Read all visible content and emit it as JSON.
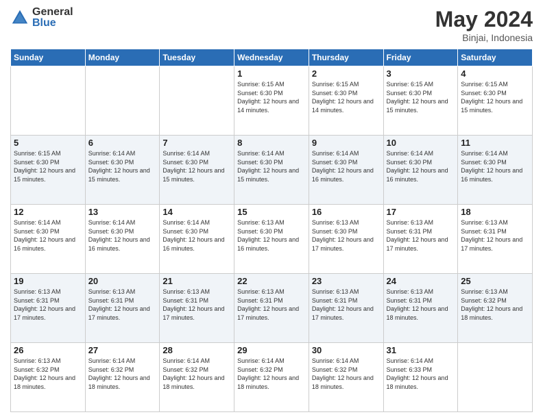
{
  "logo": {
    "general": "General",
    "blue": "Blue"
  },
  "title": "May 2024",
  "location": "Binjai, Indonesia",
  "headers": [
    "Sunday",
    "Monday",
    "Tuesday",
    "Wednesday",
    "Thursday",
    "Friday",
    "Saturday"
  ],
  "weeks": [
    [
      {
        "day": "",
        "info": ""
      },
      {
        "day": "",
        "info": ""
      },
      {
        "day": "",
        "info": ""
      },
      {
        "day": "1",
        "info": "Sunrise: 6:15 AM\nSunset: 6:30 PM\nDaylight: 12 hours and 14 minutes."
      },
      {
        "day": "2",
        "info": "Sunrise: 6:15 AM\nSunset: 6:30 PM\nDaylight: 12 hours and 14 minutes."
      },
      {
        "day": "3",
        "info": "Sunrise: 6:15 AM\nSunset: 6:30 PM\nDaylight: 12 hours and 15 minutes."
      },
      {
        "day": "4",
        "info": "Sunrise: 6:15 AM\nSunset: 6:30 PM\nDaylight: 12 hours and 15 minutes."
      }
    ],
    [
      {
        "day": "5",
        "info": "Sunrise: 6:15 AM\nSunset: 6:30 PM\nDaylight: 12 hours and 15 minutes."
      },
      {
        "day": "6",
        "info": "Sunrise: 6:14 AM\nSunset: 6:30 PM\nDaylight: 12 hours and 15 minutes."
      },
      {
        "day": "7",
        "info": "Sunrise: 6:14 AM\nSunset: 6:30 PM\nDaylight: 12 hours and 15 minutes."
      },
      {
        "day": "8",
        "info": "Sunrise: 6:14 AM\nSunset: 6:30 PM\nDaylight: 12 hours and 15 minutes."
      },
      {
        "day": "9",
        "info": "Sunrise: 6:14 AM\nSunset: 6:30 PM\nDaylight: 12 hours and 16 minutes."
      },
      {
        "day": "10",
        "info": "Sunrise: 6:14 AM\nSunset: 6:30 PM\nDaylight: 12 hours and 16 minutes."
      },
      {
        "day": "11",
        "info": "Sunrise: 6:14 AM\nSunset: 6:30 PM\nDaylight: 12 hours and 16 minutes."
      }
    ],
    [
      {
        "day": "12",
        "info": "Sunrise: 6:14 AM\nSunset: 6:30 PM\nDaylight: 12 hours and 16 minutes."
      },
      {
        "day": "13",
        "info": "Sunrise: 6:14 AM\nSunset: 6:30 PM\nDaylight: 12 hours and 16 minutes."
      },
      {
        "day": "14",
        "info": "Sunrise: 6:14 AM\nSunset: 6:30 PM\nDaylight: 12 hours and 16 minutes."
      },
      {
        "day": "15",
        "info": "Sunrise: 6:13 AM\nSunset: 6:30 PM\nDaylight: 12 hours and 16 minutes."
      },
      {
        "day": "16",
        "info": "Sunrise: 6:13 AM\nSunset: 6:30 PM\nDaylight: 12 hours and 17 minutes."
      },
      {
        "day": "17",
        "info": "Sunrise: 6:13 AM\nSunset: 6:31 PM\nDaylight: 12 hours and 17 minutes."
      },
      {
        "day": "18",
        "info": "Sunrise: 6:13 AM\nSunset: 6:31 PM\nDaylight: 12 hours and 17 minutes."
      }
    ],
    [
      {
        "day": "19",
        "info": "Sunrise: 6:13 AM\nSunset: 6:31 PM\nDaylight: 12 hours and 17 minutes."
      },
      {
        "day": "20",
        "info": "Sunrise: 6:13 AM\nSunset: 6:31 PM\nDaylight: 12 hours and 17 minutes."
      },
      {
        "day": "21",
        "info": "Sunrise: 6:13 AM\nSunset: 6:31 PM\nDaylight: 12 hours and 17 minutes."
      },
      {
        "day": "22",
        "info": "Sunrise: 6:13 AM\nSunset: 6:31 PM\nDaylight: 12 hours and 17 minutes."
      },
      {
        "day": "23",
        "info": "Sunrise: 6:13 AM\nSunset: 6:31 PM\nDaylight: 12 hours and 17 minutes."
      },
      {
        "day": "24",
        "info": "Sunrise: 6:13 AM\nSunset: 6:31 PM\nDaylight: 12 hours and 18 minutes."
      },
      {
        "day": "25",
        "info": "Sunrise: 6:13 AM\nSunset: 6:32 PM\nDaylight: 12 hours and 18 minutes."
      }
    ],
    [
      {
        "day": "26",
        "info": "Sunrise: 6:13 AM\nSunset: 6:32 PM\nDaylight: 12 hours and 18 minutes."
      },
      {
        "day": "27",
        "info": "Sunrise: 6:14 AM\nSunset: 6:32 PM\nDaylight: 12 hours and 18 minutes."
      },
      {
        "day": "28",
        "info": "Sunrise: 6:14 AM\nSunset: 6:32 PM\nDaylight: 12 hours and 18 minutes."
      },
      {
        "day": "29",
        "info": "Sunrise: 6:14 AM\nSunset: 6:32 PM\nDaylight: 12 hours and 18 minutes."
      },
      {
        "day": "30",
        "info": "Sunrise: 6:14 AM\nSunset: 6:32 PM\nDaylight: 12 hours and 18 minutes."
      },
      {
        "day": "31",
        "info": "Sunrise: 6:14 AM\nSunset: 6:33 PM\nDaylight: 12 hours and 18 minutes."
      },
      {
        "day": "",
        "info": ""
      }
    ]
  ]
}
